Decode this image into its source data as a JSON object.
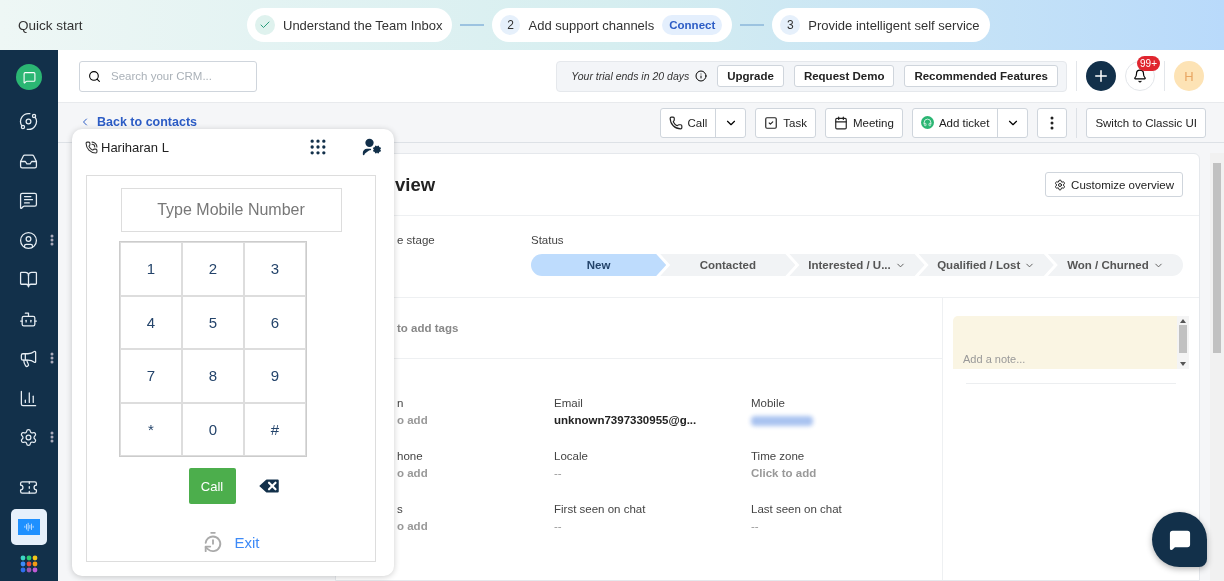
{
  "quick_start": {
    "title": "Quick start",
    "steps": [
      {
        "label": "Understand the Team Inbox",
        "done": true
      },
      {
        "number": "2",
        "label": "Add support channels",
        "badge": "Connect",
        "done": false
      },
      {
        "number": "3",
        "label": "Provide intelligent self service",
        "done": false
      }
    ]
  },
  "sidebar": {
    "items": [
      {
        "selected": false,
        "has_menu": false
      },
      {
        "selected": false,
        "has_menu": false
      },
      {
        "selected": false,
        "has_menu": false
      },
      {
        "selected": false,
        "has_menu": true
      },
      {
        "selected": false,
        "has_menu": false
      },
      {
        "selected": false,
        "has_menu": false
      },
      {
        "selected": false,
        "has_menu": true
      },
      {
        "selected": false,
        "has_menu": false
      },
      {
        "selected": false,
        "has_menu": true
      },
      {
        "selected": false,
        "has_menu": false
      },
      {
        "selected": true,
        "has_menu": false
      }
    ]
  },
  "header": {
    "search": {
      "placeholder": "Search your CRM..."
    },
    "trial": "Your trial ends in 20 days",
    "buttons": [
      "Upgrade",
      "Request Demo",
      "Recommended Features"
    ],
    "notifications": "99+",
    "avatar": "H"
  },
  "toolbar": {
    "back": "Back to contacts",
    "actions": [
      {
        "kind": "split",
        "label": "Call"
      },
      {
        "kind": "plain",
        "label": "Task"
      },
      {
        "kind": "plain",
        "label": "Meeting"
      },
      {
        "kind": "split",
        "label": "Add ticket"
      },
      {
        "kind": "more"
      },
      {
        "kind": "text",
        "label": "Switch to Classic UI"
      }
    ]
  },
  "overview": {
    "title": "view",
    "customize": "Customize overview",
    "stage_label": "e stage",
    "status_label": "Status",
    "stages": [
      {
        "label": "New",
        "selected": true,
        "dropdown": false
      },
      {
        "label": "Contacted",
        "selected": false,
        "dropdown": false
      },
      {
        "label": "Interested / U...",
        "selected": false,
        "dropdown": true
      },
      {
        "label": "Qualified / Lost",
        "selected": false,
        "dropdown": true
      },
      {
        "label": "Won / Churned",
        "selected": false,
        "dropdown": true
      }
    ],
    "tags": "to add tags",
    "fields": [
      {
        "label": "n",
        "value": "o add",
        "kind": "action"
      },
      {
        "label": "Email",
        "value": "unknown7397330955@g...",
        "kind": "text"
      },
      {
        "label": "Mobile",
        "kind": "redacted"
      },
      {
        "label": "hone",
        "value": "o add",
        "kind": "action"
      },
      {
        "label": "Locale",
        "value": "--",
        "kind": "empty"
      },
      {
        "label": "Time zone",
        "value": "Click to add",
        "kind": "action"
      },
      {
        "label": "s",
        "value": "o add",
        "kind": "action"
      },
      {
        "label": "First seen on chat",
        "value": "--",
        "kind": "empty"
      },
      {
        "label": "Last seen on chat",
        "value": "--",
        "kind": "empty"
      }
    ],
    "note": {
      "placeholder": "Add a note..."
    }
  },
  "dialer": {
    "contact": "Hariharan L",
    "placeholder": "Type Mobile Number",
    "keys": [
      "1",
      "2",
      "3",
      "4",
      "5",
      "6",
      "7",
      "8",
      "9",
      "*",
      "0",
      "#"
    ],
    "call": "Call",
    "exit": "Exit"
  }
}
